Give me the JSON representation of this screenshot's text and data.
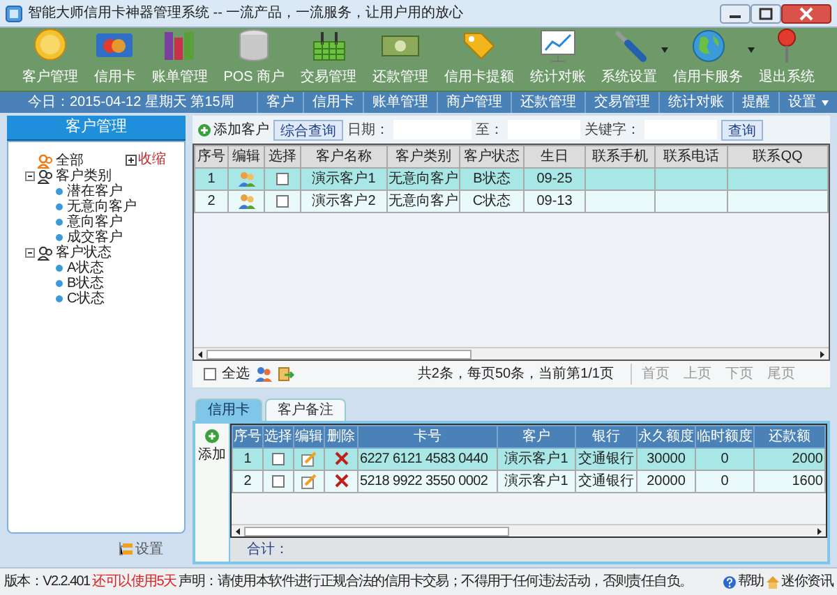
{
  "window": {
    "title": "智能大师信用卡神器管理系统 -- 一流产品，一流服务，让用户用的放心"
  },
  "toolbar": [
    {
      "label": "客户管理",
      "dropdown": false
    },
    {
      "label": "信用卡",
      "dropdown": false
    },
    {
      "label": "账单管理",
      "dropdown": false
    },
    {
      "label": "POS 商户",
      "dropdown": false
    },
    {
      "label": "交易管理",
      "dropdown": false
    },
    {
      "label": "还款管理",
      "dropdown": false
    },
    {
      "label": "信用卡提额",
      "dropdown": false
    },
    {
      "label": "统计对账",
      "dropdown": false
    },
    {
      "label": "系统设置",
      "dropdown": true
    },
    {
      "label": "信用卡服务",
      "dropdown": true
    },
    {
      "label": "退出系统",
      "dropdown": false
    }
  ],
  "nav_bar": {
    "date": "今日：2015-04-12 星期天 第15周",
    "items": [
      {
        "label": "客户",
        "dropdown": false
      },
      {
        "label": "信用卡",
        "dropdown": false
      },
      {
        "label": "账单管理",
        "dropdown": false
      },
      {
        "label": "商户管理",
        "dropdown": false
      },
      {
        "label": "还款管理",
        "dropdown": false
      },
      {
        "label": "交易管理",
        "dropdown": false
      },
      {
        "label": "统计对账",
        "dropdown": false
      },
      {
        "label": "提醒",
        "dropdown": false
      },
      {
        "label": "设置",
        "dropdown": true
      }
    ]
  },
  "sidebar": {
    "title": "客户管理",
    "collapse_link": "收缩",
    "tree": [
      {
        "label": "全部"
      },
      {
        "label": "客户类别",
        "children": [
          {
            "label": "潜在客户"
          },
          {
            "label": "无意向客户"
          },
          {
            "label": "意向客户"
          },
          {
            "label": "成交客户"
          }
        ]
      },
      {
        "label": "客户状态",
        "children": [
          {
            "label": "A状态"
          },
          {
            "label": "B状态"
          },
          {
            "label": "C状态"
          }
        ]
      }
    ],
    "settings": "设置"
  },
  "search_bar": {
    "add_button": "添加客户",
    "query_tab": "综合查询",
    "date_label": "日期：",
    "to_label": "至：",
    "keyword_label": "关键字：",
    "search_button": "查询"
  },
  "customer_table": {
    "columns": [
      "序号",
      "编辑",
      "选择",
      "客户名称",
      "客户类别",
      "客户状态",
      "生日",
      "联系手机",
      "联系电话",
      "联系QQ"
    ],
    "rows": [
      {
        "no": "1",
        "checked": false,
        "selected": true,
        "name": "演示客户1",
        "category": "无意向客户",
        "status": "B状态",
        "birthday": "09-25"
      },
      {
        "no": "2",
        "checked": false,
        "selected": false,
        "name": "演示客户2",
        "category": "无意向客户",
        "status": "C状态",
        "birthday": "09-13"
      }
    ]
  },
  "pager": {
    "select_all": "全选",
    "select_all_checked": false,
    "summary": "共2条，每页50条，当前第1/1页",
    "links": [
      "首页",
      "上页",
      "下页",
      "尾页"
    ]
  },
  "tabs": [
    {
      "label": "信用卡",
      "selected": true
    },
    {
      "label": "客户备注",
      "selected": false
    }
  ],
  "card_panel": {
    "add_button": "添加",
    "columns": [
      "序号",
      "选择",
      "编辑",
      "删除",
      "卡号",
      "客户",
      "银行",
      "永久额度",
      "临时额度",
      "还款额"
    ],
    "rows": [
      {
        "no": "1",
        "checked": false,
        "selected": true,
        "card": "6227 6121 4583 0440",
        "customer": "演示客户1",
        "bank": "交通银行",
        "permanent": "30000",
        "temporary": "0",
        "repay": "2000"
      },
      {
        "no": "2",
        "checked": false,
        "selected": false,
        "card": "5218 9922 3550 0002",
        "customer": "演示客户1",
        "bank": "交通银行",
        "permanent": "20000",
        "temporary": "0",
        "repay": "1600"
      }
    ],
    "total_label": "合计："
  },
  "status_bar": {
    "version": "版本：V2.2.401",
    "trial": "还可以使用5天",
    "notice": "声明：请使用本软件进行正规合法的信用卡交易；不得用于任何违法活动，否则责任自负。",
    "help": "帮助",
    "news": "迷你资讯"
  }
}
